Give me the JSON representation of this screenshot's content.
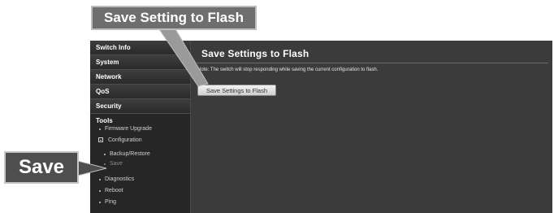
{
  "callouts": {
    "top": "Save Setting to Flash",
    "left": "Save"
  },
  "sidebar": {
    "items": [
      "Switch Info",
      "System",
      "Network",
      "QoS",
      "Security"
    ],
    "tools": {
      "label": "Tools",
      "firmware": "Firmware Upgrade",
      "configuration": "Configuration",
      "backup": "Backup/Restore",
      "save": "Save",
      "diagnostics": "Diagnostics",
      "reboot": "Reboot",
      "ping": "Ping"
    }
  },
  "content": {
    "title": "Save Settings to Flash",
    "note": "Note: The switch will stop responding while saving the current configuration to flash.",
    "button": "Save Settings to Flash"
  },
  "colors": {
    "sidebar_bg": "#262626",
    "content_bg": "#3b3b3b",
    "callout_top_bg": "#6e6e6e",
    "callout_left_bg": "#4e4e4e"
  }
}
